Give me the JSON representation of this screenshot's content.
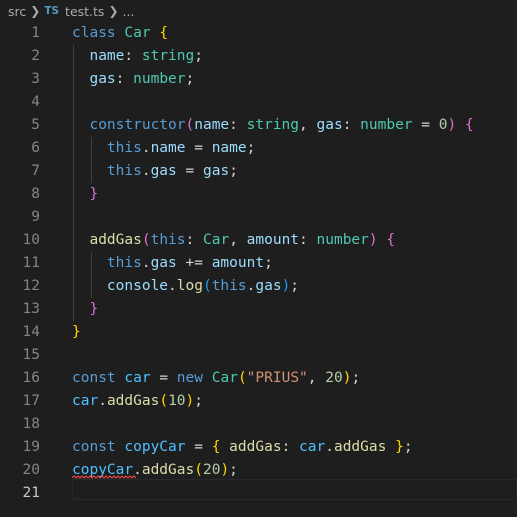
{
  "breadcrumb": {
    "folder": "src",
    "file_icon": "TS",
    "file": "test.ts",
    "more": "..."
  },
  "lines": [
    {
      "n": "1",
      "tokens": [
        [
          "kw",
          "class"
        ],
        [
          "plain",
          " "
        ],
        [
          "cls",
          "Car"
        ],
        [
          "plain",
          " "
        ],
        [
          "br1",
          "{"
        ]
      ]
    },
    {
      "n": "2",
      "tokens": [
        [
          "plain",
          "  "
        ],
        [
          "var",
          "name"
        ],
        [
          "plain",
          ": "
        ],
        [
          "cls",
          "string"
        ],
        [
          "plain",
          ";"
        ]
      ]
    },
    {
      "n": "3",
      "tokens": [
        [
          "plain",
          "  "
        ],
        [
          "var",
          "gas"
        ],
        [
          "plain",
          ": "
        ],
        [
          "cls",
          "number"
        ],
        [
          "plain",
          ";"
        ]
      ]
    },
    {
      "n": "4",
      "tokens": []
    },
    {
      "n": "5",
      "tokens": [
        [
          "plain",
          "  "
        ],
        [
          "kw",
          "constructor"
        ],
        [
          "br2",
          "("
        ],
        [
          "var",
          "name"
        ],
        [
          "plain",
          ": "
        ],
        [
          "cls",
          "string"
        ],
        [
          "plain",
          ", "
        ],
        [
          "var",
          "gas"
        ],
        [
          "plain",
          ": "
        ],
        [
          "cls",
          "number"
        ],
        [
          "plain",
          " = "
        ],
        [
          "num",
          "0"
        ],
        [
          "br2",
          ")"
        ],
        [
          "plain",
          " "
        ],
        [
          "br2",
          "{"
        ]
      ]
    },
    {
      "n": "6",
      "tokens": [
        [
          "plain",
          "    "
        ],
        [
          "kw",
          "this"
        ],
        [
          "plain",
          "."
        ],
        [
          "var",
          "name"
        ],
        [
          "plain",
          " = "
        ],
        [
          "var",
          "name"
        ],
        [
          "plain",
          ";"
        ]
      ]
    },
    {
      "n": "7",
      "tokens": [
        [
          "plain",
          "    "
        ],
        [
          "kw",
          "this"
        ],
        [
          "plain",
          "."
        ],
        [
          "var",
          "gas"
        ],
        [
          "plain",
          " = "
        ],
        [
          "var",
          "gas"
        ],
        [
          "plain",
          ";"
        ]
      ]
    },
    {
      "n": "8",
      "tokens": [
        [
          "plain",
          "  "
        ],
        [
          "br2",
          "}"
        ]
      ]
    },
    {
      "n": "9",
      "tokens": []
    },
    {
      "n": "10",
      "tokens": [
        [
          "plain",
          "  "
        ],
        [
          "fn",
          "addGas"
        ],
        [
          "br2",
          "("
        ],
        [
          "kw",
          "this"
        ],
        [
          "plain",
          ": "
        ],
        [
          "cls",
          "Car"
        ],
        [
          "plain",
          ", "
        ],
        [
          "var",
          "amount"
        ],
        [
          "plain",
          ": "
        ],
        [
          "cls",
          "number"
        ],
        [
          "br2",
          ")"
        ],
        [
          "plain",
          " "
        ],
        [
          "br2",
          "{"
        ]
      ]
    },
    {
      "n": "11",
      "tokens": [
        [
          "plain",
          "    "
        ],
        [
          "kw",
          "this"
        ],
        [
          "plain",
          "."
        ],
        [
          "var",
          "gas"
        ],
        [
          "plain",
          " += "
        ],
        [
          "var",
          "amount"
        ],
        [
          "plain",
          ";"
        ]
      ]
    },
    {
      "n": "12",
      "tokens": [
        [
          "plain",
          "    "
        ],
        [
          "var",
          "console"
        ],
        [
          "plain",
          "."
        ],
        [
          "fn",
          "log"
        ],
        [
          "br3",
          "("
        ],
        [
          "kw",
          "this"
        ],
        [
          "plain",
          "."
        ],
        [
          "var",
          "gas"
        ],
        [
          "br3",
          ")"
        ],
        [
          "plain",
          ";"
        ]
      ]
    },
    {
      "n": "13",
      "tokens": [
        [
          "plain",
          "  "
        ],
        [
          "br2",
          "}"
        ]
      ]
    },
    {
      "n": "14",
      "tokens": [
        [
          "br1",
          "}"
        ]
      ]
    },
    {
      "n": "15",
      "tokens": []
    },
    {
      "n": "16",
      "tokens": [
        [
          "kw",
          "const"
        ],
        [
          "plain",
          " "
        ],
        [
          "cst",
          "car"
        ],
        [
          "plain",
          " = "
        ],
        [
          "kw",
          "new"
        ],
        [
          "plain",
          " "
        ],
        [
          "cls",
          "Car"
        ],
        [
          "br1",
          "("
        ],
        [
          "str",
          "\"PRIUS\""
        ],
        [
          "plain",
          ", "
        ],
        [
          "num",
          "20"
        ],
        [
          "br1",
          ")"
        ],
        [
          "plain",
          ";"
        ]
      ]
    },
    {
      "n": "17",
      "tokens": [
        [
          "cst",
          "car"
        ],
        [
          "plain",
          "."
        ],
        [
          "fn",
          "addGas"
        ],
        [
          "br1",
          "("
        ],
        [
          "num",
          "10"
        ],
        [
          "br1",
          ")"
        ],
        [
          "plain",
          ";"
        ]
      ]
    },
    {
      "n": "18",
      "tokens": []
    },
    {
      "n": "19",
      "tokens": [
        [
          "kw",
          "const"
        ],
        [
          "plain",
          " "
        ],
        [
          "cst",
          "copyCar"
        ],
        [
          "plain",
          " = "
        ],
        [
          "br1",
          "{"
        ],
        [
          "plain",
          " "
        ],
        [
          "fn",
          "addGas"
        ],
        [
          "plain",
          ": "
        ],
        [
          "cst",
          "car"
        ],
        [
          "plain",
          "."
        ],
        [
          "fn",
          "addGas"
        ],
        [
          "plain",
          " "
        ],
        [
          "br1",
          "}"
        ],
        [
          "plain",
          ";"
        ]
      ]
    },
    {
      "n": "20",
      "tokens": [
        [
          "cst",
          "copyCar"
        ],
        [
          "plain",
          "."
        ],
        [
          "fn",
          "addGas"
        ],
        [
          "br1",
          "("
        ],
        [
          "num",
          "20"
        ],
        [
          "br1",
          ")"
        ],
        [
          "plain",
          ";"
        ]
      ]
    },
    {
      "n": "21",
      "tokens": []
    }
  ],
  "active_line": "21",
  "colors": {
    "background": "#1e1e1e",
    "line_number": "#858585",
    "error_squiggle": "#f14c4c"
  }
}
